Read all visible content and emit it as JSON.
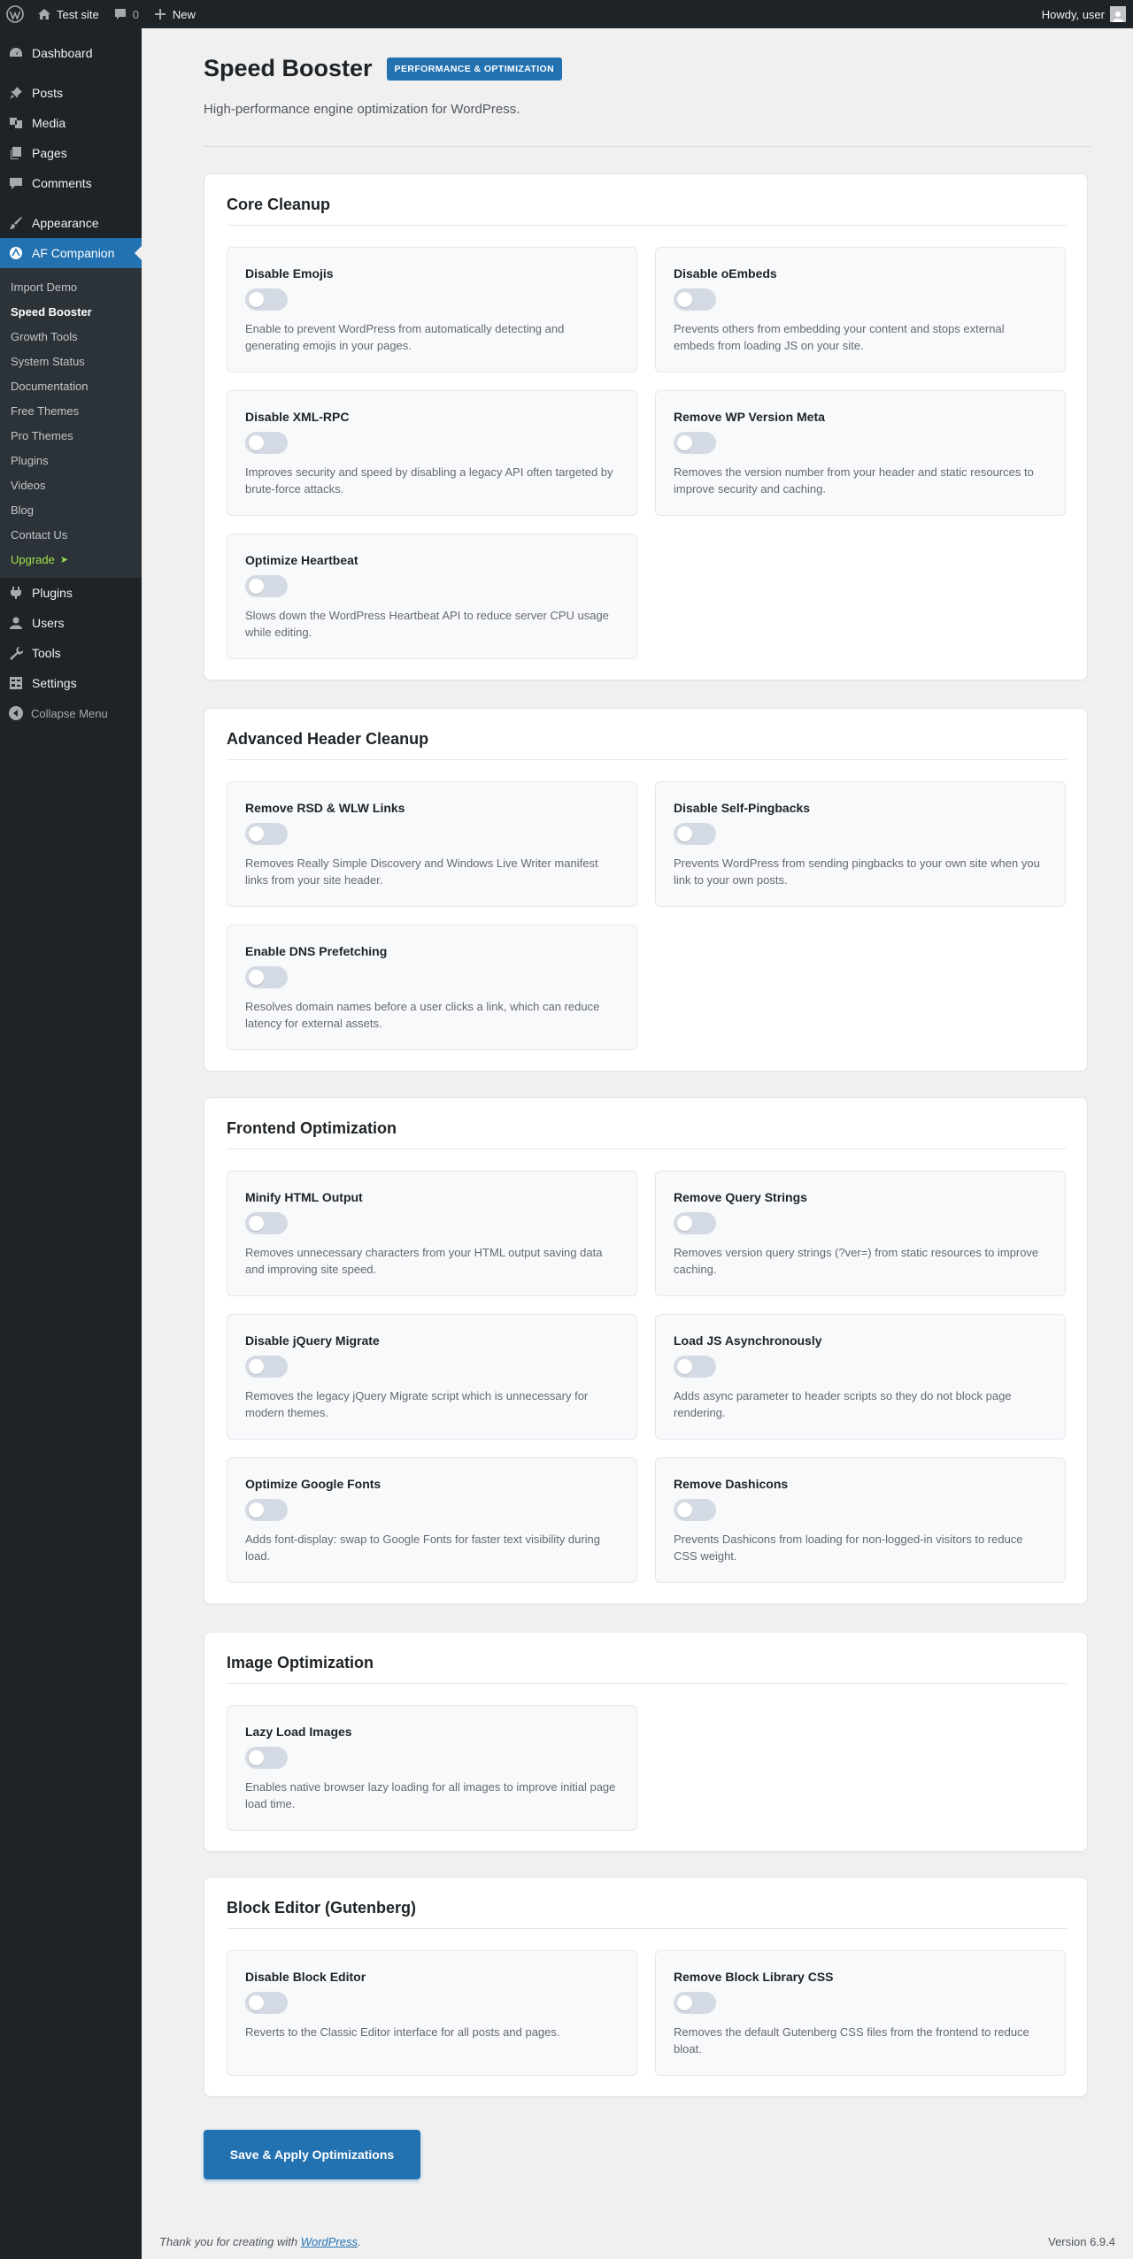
{
  "admin_bar": {
    "site_name": "Test site",
    "comments_count": "0",
    "new_label": "New",
    "greeting": "Howdy, user"
  },
  "sidebar": {
    "items_top": [
      {
        "label": "Dashboard",
        "icon": "dashboard-icon"
      }
    ],
    "items_content": [
      {
        "label": "Posts",
        "icon": "pin-icon"
      },
      {
        "label": "Media",
        "icon": "media-icon"
      },
      {
        "label": "Pages",
        "icon": "pages-icon"
      },
      {
        "label": "Comments",
        "icon": "comment-icon"
      }
    ],
    "appearance": {
      "label": "Appearance",
      "icon": "brush-icon"
    },
    "current": {
      "label": "AF Companion",
      "icon": "companion-icon"
    },
    "submenu": [
      "Import Demo",
      "Speed Booster",
      "Growth Tools",
      "System Status",
      "Documentation",
      "Free Themes",
      "Pro Themes",
      "Plugins",
      "Videos",
      "Blog",
      "Contact Us"
    ],
    "upgrade_label": "Upgrade",
    "upgrade_arrow": "➤",
    "items_bottom": [
      {
        "label": "Plugins",
        "icon": "plugin-icon"
      },
      {
        "label": "Users",
        "icon": "user-icon"
      },
      {
        "label": "Tools",
        "icon": "wrench-icon"
      },
      {
        "label": "Settings",
        "icon": "settings-icon"
      }
    ],
    "collapse_label": "Collapse Menu"
  },
  "header": {
    "title": "Speed Booster",
    "badge": "PERFORMANCE & OPTIMIZATION",
    "subtitle": "High-performance engine optimization for WordPress."
  },
  "sections": [
    {
      "title": "Core Cleanup",
      "cards": [
        {
          "title": "Disable Emojis",
          "enabled": false,
          "desc": [
            "Enable to prevent WordPress from automatically detecting and",
            "generating emojis in your pages."
          ]
        },
        {
          "title": "Disable oEmbeds",
          "enabled": false,
          "desc": [
            "Prevents others from embedding your content and stops external",
            "embeds from loading JS on your site."
          ]
        },
        {
          "title": "Disable XML-RPC",
          "enabled": false,
          "desc": [
            "Improves security and speed by disabling a legacy API often targeted by",
            "brute-force attacks."
          ]
        },
        {
          "title": "Remove WP Version Meta",
          "enabled": false,
          "desc": [
            "Removes the version number from your header and static resources to",
            "improve security and caching."
          ]
        },
        {
          "title": "Optimize Heartbeat",
          "enabled": false,
          "desc": [
            "Slows down the WordPress Heartbeat API to reduce server CPU usage",
            "while editing."
          ]
        }
      ]
    },
    {
      "title": "Advanced Header Cleanup",
      "cards": [
        {
          "title": "Remove RSD & WLW Links",
          "enabled": false,
          "desc": [
            "Removes Really Simple Discovery and Windows Live Writer manifest",
            "links from your site header."
          ]
        },
        {
          "title": "Disable Self-Pingbacks",
          "enabled": false,
          "desc": [
            "Prevents WordPress from sending pingbacks to your own site when you",
            "link to your own posts."
          ]
        },
        {
          "title": "Enable DNS Prefetching",
          "enabled": false,
          "desc": [
            "Resolves domain names before a user clicks a link, which can reduce",
            "latency for external assets."
          ]
        }
      ]
    },
    {
      "title": "Frontend Optimization",
      "cards": [
        {
          "title": "Minify HTML Output",
          "enabled": false,
          "desc": [
            "Removes unnecessary characters from your HTML output saving data",
            "and improving site speed."
          ]
        },
        {
          "title": "Remove Query Strings",
          "enabled": false,
          "desc": [
            "Removes version query strings (?ver=) from static resources to improve",
            "caching."
          ]
        },
        {
          "title": "Disable jQuery Migrate",
          "enabled": false,
          "desc": [
            "Removes the legacy jQuery Migrate script which is unnecessary for",
            "modern themes."
          ]
        },
        {
          "title": "Load JS Asynchronously",
          "enabled": false,
          "desc": [
            "Adds async parameter to header scripts so they do not block page",
            "rendering."
          ]
        },
        {
          "title": "Optimize Google Fonts",
          "enabled": false,
          "desc": [
            "Adds font-display: swap to Google Fonts for faster text visibility during",
            "load."
          ]
        },
        {
          "title": "Remove Dashicons",
          "enabled": false,
          "desc": [
            "Prevents Dashicons from loading for non-logged-in visitors to reduce",
            "CSS weight."
          ]
        }
      ]
    },
    {
      "title": "Image Optimization",
      "cards": [
        {
          "title": "Lazy Load Images",
          "enabled": false,
          "desc": [
            "Enables native browser lazy loading for all images to improve initial page",
            "load time."
          ]
        }
      ]
    },
    {
      "title": "Block Editor (Gutenberg)",
      "cards": [
        {
          "title": "Disable Block Editor",
          "enabled": false,
          "desc": [
            "Reverts to the Classic Editor interface for all posts and pages."
          ]
        },
        {
          "title": "Remove Block Library CSS",
          "enabled": false,
          "desc": [
            "Removes the default Gutenberg CSS files from the frontend to reduce",
            "bloat."
          ]
        }
      ]
    }
  ],
  "save_button_label": "Save & Apply Optimizations",
  "footer": {
    "thanks_prefix": "Thank you for creating with ",
    "thanks_link": "WordPress",
    "thanks_suffix": ".",
    "version": "Version 6.9.4"
  },
  "colors": {
    "accent": "#2271b1",
    "sidebar_bg": "#1d2327",
    "submenu_bg": "#2c3338",
    "upgrade": "#9ee14a",
    "toggle_off": "#d4dae3"
  }
}
